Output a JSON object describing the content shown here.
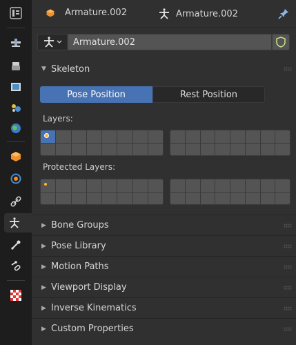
{
  "header": {
    "object_name": "Armature.002",
    "data_name": "Armature.002"
  },
  "datablock": {
    "name": "Armature.002"
  },
  "skeleton": {
    "title": "Skeleton",
    "pose_position_label": "Pose Position",
    "rest_position_label": "Rest Position",
    "layers_label": "Layers:",
    "protected_layers_label": "Protected Layers:"
  },
  "panels": [
    {
      "label": "Bone Groups"
    },
    {
      "label": "Pose Library"
    },
    {
      "label": "Motion Paths"
    },
    {
      "label": "Viewport Display"
    },
    {
      "label": "Inverse Kinematics"
    },
    {
      "label": "Custom Properties"
    }
  ],
  "colors": {
    "accent": "#4772b3",
    "panel_bg": "#303030",
    "field_bg": "#545454",
    "layer_dot": "#ffb43a"
  },
  "tab_icons": [
    "tool-icon",
    "render-icon",
    "output-icon",
    "view-layer-icon",
    "scene-icon",
    "world-icon",
    "object-icon",
    "modifier-icon",
    "constraint-icon",
    "armature-data-icon",
    "bone-icon",
    "bone-constraint-icon",
    "texture-icon"
  ]
}
